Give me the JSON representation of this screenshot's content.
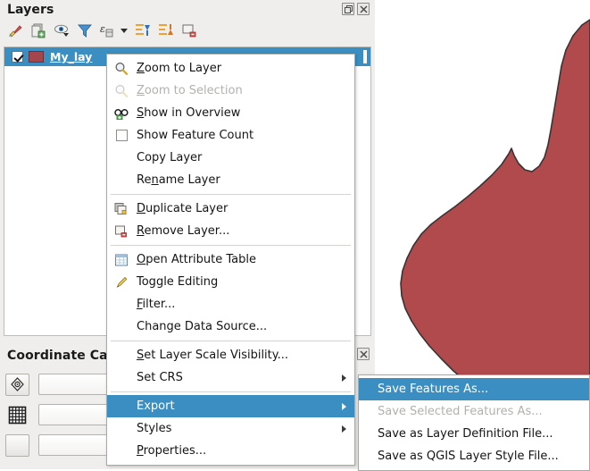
{
  "panels": {
    "layers": {
      "title": "Layers",
      "float_button": "float-panel",
      "close_button": "close-panel",
      "toolbar": [
        {
          "name": "open-layer-styling-panel",
          "icon": "paintbrush-icon"
        },
        {
          "name": "add-group",
          "icon": "add-group-icon"
        },
        {
          "name": "manage-map-themes",
          "icon": "eye-icon"
        },
        {
          "name": "filter-legend-by-map-content",
          "icon": "filter-icon"
        },
        {
          "name": "filter-legend-by-expression",
          "icon": "expression-filter-icon"
        },
        {
          "name": "expand-all",
          "icon": "expand-all-icon"
        },
        {
          "name": "collapse-all",
          "icon": "collapse-all-icon"
        },
        {
          "name": "remove-layer-group",
          "icon": "remove-layer-icon"
        }
      ],
      "layer": {
        "name": "My_lay",
        "checked": true,
        "symbol_color": "#a5464c"
      }
    },
    "coordinate_capture": {
      "title": "Coordinate Capture",
      "buttons": [
        {
          "name": "start-capture",
          "icon": "crosshair-icon"
        },
        {
          "name": "coordinate-grid",
          "icon": "grid-icon"
        }
      ],
      "fields": [
        {
          "name": "coordinate-field-1",
          "value": "",
          "placeholder": ""
        },
        {
          "name": "coordinate-field-2",
          "value": "",
          "placeholder": ""
        },
        {
          "name": "coordinate-field-3",
          "value": "",
          "placeholder": ""
        }
      ],
      "float_button": "float-panel",
      "close_button": "close-panel"
    }
  },
  "context_menu": {
    "groups": [
      {
        "items": [
          {
            "label": "Zoom to Layer",
            "mnemonic": "Z",
            "icon": "zoom-to-layer-icon",
            "enabled": true,
            "submenu": false
          },
          {
            "label": "Zoom to Selection",
            "mnemonic": "Z",
            "icon": "zoom-to-selection-icon",
            "enabled": false,
            "submenu": false
          },
          {
            "label": "Show in Overview",
            "mnemonic": "S",
            "icon": "show-in-overview-icon",
            "enabled": true,
            "submenu": false
          },
          {
            "label": "Show Feature Count",
            "mnemonic": "",
            "icon": "checkbox-icon",
            "enabled": true,
            "submenu": false
          },
          {
            "label": "Copy Layer",
            "mnemonic": "",
            "icon": "none",
            "enabled": true,
            "submenu": false
          },
          {
            "label": "Rename Layer",
            "mnemonic": "n",
            "icon": "none",
            "enabled": true,
            "submenu": false
          }
        ]
      },
      {
        "items": [
          {
            "label": "Duplicate Layer",
            "mnemonic": "D",
            "icon": "duplicate-layer-icon",
            "enabled": true,
            "submenu": false
          },
          {
            "label": "Remove Layer...",
            "mnemonic": "R",
            "icon": "remove-layer-icon",
            "enabled": true,
            "submenu": false
          }
        ]
      },
      {
        "items": [
          {
            "label": "Open Attribute Table",
            "mnemonic": "O",
            "icon": "attribute-table-icon",
            "enabled": true,
            "submenu": false
          },
          {
            "label": "Toggle Editing",
            "mnemonic": "",
            "icon": "pencil-icon",
            "enabled": true,
            "submenu": false
          },
          {
            "label": "Filter...",
            "mnemonic": "F",
            "icon": "none",
            "enabled": true,
            "submenu": false
          },
          {
            "label": "Change Data Source...",
            "mnemonic": "",
            "icon": "none",
            "enabled": true,
            "submenu": false
          }
        ]
      },
      {
        "items": [
          {
            "label": "Set Layer Scale Visibility...",
            "mnemonic": "S",
            "icon": "none",
            "enabled": true,
            "submenu": false
          },
          {
            "label": "Set CRS",
            "mnemonic": "",
            "icon": "none",
            "enabled": true,
            "submenu": true
          }
        ]
      },
      {
        "items": [
          {
            "label": "Export",
            "mnemonic": "",
            "icon": "none",
            "enabled": true,
            "submenu": true,
            "selected": true
          },
          {
            "label": "Styles",
            "mnemonic": "",
            "icon": "none",
            "enabled": true,
            "submenu": true
          },
          {
            "label": "Properties...",
            "mnemonic": "P",
            "icon": "none",
            "enabled": true,
            "submenu": false
          }
        ]
      }
    ]
  },
  "export_submenu": {
    "items": [
      {
        "label": "Save Features As...",
        "enabled": true,
        "selected": true
      },
      {
        "label": "Save Selected Features As...",
        "enabled": false,
        "selected": false
      },
      {
        "label": "Save as Layer Definition File...",
        "enabled": true,
        "selected": false
      },
      {
        "label": "Save as QGIS Layer Style File...",
        "enabled": true,
        "selected": false
      }
    ]
  },
  "map": {
    "background_color": "#ffffff",
    "polygon_fill": "#b04a4d",
    "polygon_stroke": "#3a3234"
  },
  "colors": {
    "highlight": "#3b8ec2",
    "panel_background": "#efeeec",
    "disabled_text": "#b3b1ae"
  }
}
